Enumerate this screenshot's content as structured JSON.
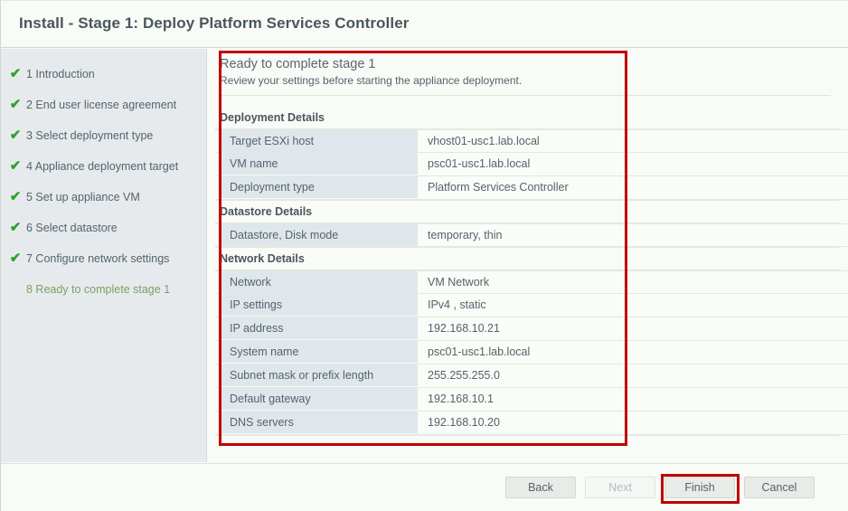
{
  "window": {
    "title": "Install - Stage 1: Deploy Platform Services Controller"
  },
  "sidebar": {
    "steps": [
      {
        "label": "1 Introduction",
        "state": "done",
        "check": "✔"
      },
      {
        "label": "2 End user license agreement",
        "state": "done",
        "check": "✔"
      },
      {
        "label": "3 Select deployment type",
        "state": "done",
        "check": "✔"
      },
      {
        "label": "4 Appliance deployment target",
        "state": "done",
        "check": "✔"
      },
      {
        "label": "5 Set up appliance VM",
        "state": "done",
        "check": "✔"
      },
      {
        "label": "6 Select datastore",
        "state": "done",
        "check": "✔"
      },
      {
        "label": "7 Configure network settings",
        "state": "done",
        "check": "✔"
      },
      {
        "label": "8 Ready to complete stage 1",
        "state": "active",
        "check": ""
      }
    ]
  },
  "pane": {
    "title": "Ready to complete stage 1",
    "subtitle": "Review your settings before starting the appliance deployment."
  },
  "sections": [
    {
      "heading": "Deployment Details",
      "rows": [
        {
          "label": "Target ESXi host",
          "value": "vhost01-usc1.lab.local"
        },
        {
          "label": "VM name",
          "value": "psc01-usc1.lab.local"
        },
        {
          "label": "Deployment type",
          "value": "Platform Services Controller"
        }
      ]
    },
    {
      "heading": "Datastore Details",
      "rows": [
        {
          "label": "Datastore, Disk mode",
          "value": "temporary, thin"
        }
      ]
    },
    {
      "heading": "Network Details",
      "rows": [
        {
          "label": "Network",
          "value": "VM Network"
        },
        {
          "label": "IP settings",
          "value": "IPv4 , static"
        },
        {
          "label": "IP address",
          "value": "192.168.10.21"
        },
        {
          "label": "System name",
          "value": "psc01-usc1.lab.local"
        },
        {
          "label": "Subnet mask or prefix length",
          "value": "255.255.255.0"
        },
        {
          "label": "Default gateway",
          "value": "192.168.10.1"
        },
        {
          "label": "DNS servers",
          "value": "192.168.10.20"
        }
      ]
    }
  ],
  "footer": {
    "back_label": "Back",
    "next_label": "Next",
    "finish_label": "Finish",
    "cancel_label": "Cancel"
  },
  "annotations": {
    "color": "#c00000",
    "content_box": "highlight around review summary",
    "finish_box": "highlight around Finish button"
  }
}
